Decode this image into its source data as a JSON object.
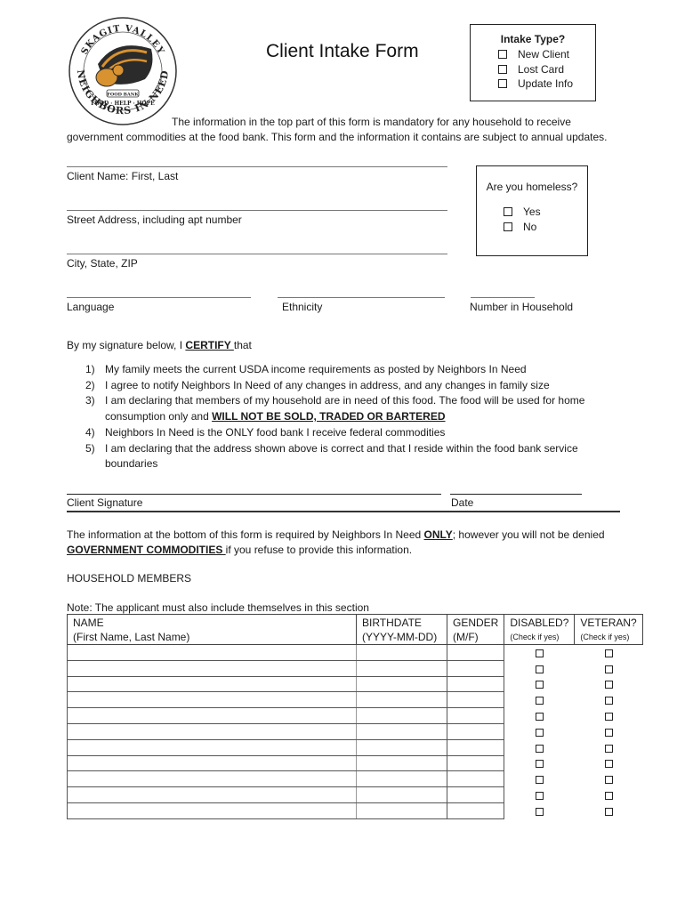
{
  "logo": {
    "top_arc": "SKAGIT VALLEY",
    "bottom_arc": "NEIGHBORS IN NEED",
    "motto": "FOOD · HELP · HOPE",
    "banner": "FOOD BANK",
    "colors": {
      "orange": "#d99230",
      "dark": "#2b2b2b"
    }
  },
  "title": "Client Intake Form",
  "intake_type": {
    "heading": "Intake Type?",
    "options": [
      "New Client",
      "Lost Card",
      "Update Info"
    ]
  },
  "intro": {
    "line1": "The information in the top part of this form is mandatory for any household to receive",
    "line2": "government commodities at the food bank. This form and the information it contains are subject to annual updates."
  },
  "fields": {
    "client_name": "Client Name: First, Last",
    "street": "Street Address, including apt number",
    "city": "City, State, ZIP",
    "language": "Language",
    "ethnicity": "Ethnicity",
    "household_count": "Number in Household"
  },
  "homeless": {
    "question": "Are you homeless?",
    "options": [
      "Yes",
      "No"
    ]
  },
  "certify": {
    "prefix": "By my signature below, I ",
    "keyword": "CERTIFY ",
    "suffix": "that",
    "items": [
      {
        "num": "1)",
        "text": "My family meets the current USDA income requirements as posted by Neighbors In Need"
      },
      {
        "num": "2)",
        "text": "I agree to notify Neighbors In Need of any changes in address, and any changes in family size"
      },
      {
        "num": "3)",
        "text": "I am declaring that members of my household are in need of this food. The food will be used for home consumption only and ",
        "emphasis": "WILL NOT BE SOLD, TRADED OR BARTERED"
      },
      {
        "num": "4)",
        "text": "Neighbors In Need is the ONLY food bank I receive federal commodities"
      },
      {
        "num": "5)",
        "text": "I am declaring that the address shown above is correct and that I reside within the food bank service boundaries"
      }
    ]
  },
  "signature": {
    "client_signature": "Client Signature",
    "date": "Date"
  },
  "lower_note": {
    "part1": "The information at the bottom of this form is required by Neighbors In Need ",
    "only": "ONLY",
    "part2": "; however you will not be denied",
    "gov": "GOVERNMENT COMMODITIES ",
    "part3": "if you refuse to provide this information."
  },
  "household": {
    "heading": "HOUSEHOLD MEMBERS",
    "note": "Note: The applicant must also include themselves in this section",
    "columns": [
      {
        "label": "NAME",
        "sub": "(First Name, Last Name)"
      },
      {
        "label": "BIRTHDATE",
        "sub": "(YYYY-MM-DD)"
      },
      {
        "label": "GENDER",
        "sub": "(M/F)"
      },
      {
        "label": "DISABLED?",
        "sub": "(Check if yes)"
      },
      {
        "label": "VETERAN?",
        "sub": "(Check if yes)"
      }
    ],
    "row_count": 11
  }
}
